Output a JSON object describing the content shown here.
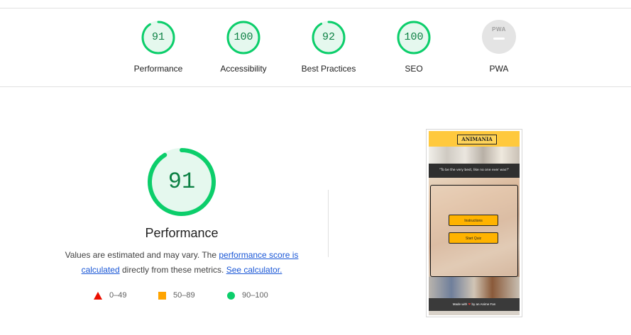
{
  "colors": {
    "pass": "#0cce6b",
    "pass_text": "#0b8043",
    "pass_bg": "#e5f8ee",
    "fail": "#eb0f00",
    "average": "#ffa400",
    "na": "#e4e4e4"
  },
  "categories": [
    {
      "label": "Performance",
      "score": "91",
      "value": 91
    },
    {
      "label": "Accessibility",
      "score": "100",
      "value": 100
    },
    {
      "label": "Best Practices",
      "score": "92",
      "value": 92
    },
    {
      "label": "SEO",
      "score": "100",
      "value": 100
    },
    {
      "label": "PWA",
      "badge_text": "PWA",
      "icon": "pwa-badge-icon"
    }
  ],
  "performance": {
    "score": "91",
    "value": 91,
    "title": "Performance",
    "desc_part1": "Values are estimated and may vary. The ",
    "desc_link1": "performance score is calculated",
    "desc_part2": " directly from these metrics. ",
    "desc_link2": "See calculator."
  },
  "legend": [
    {
      "label": "0–49",
      "icon": "triangle-icon"
    },
    {
      "label": "50–89",
      "icon": "square-icon"
    },
    {
      "label": "90–100",
      "icon": "circle-icon"
    }
  ],
  "thumbnail": {
    "logo": "ANIMANIA",
    "quote": "\"To be the very best, like no one ever was!\"",
    "btn_instructions": "Instructions",
    "btn_start": "Start Quiz",
    "footer_before": "Made with ",
    "footer_heart": "❤",
    "footer_after": " by an Anime Fan"
  }
}
